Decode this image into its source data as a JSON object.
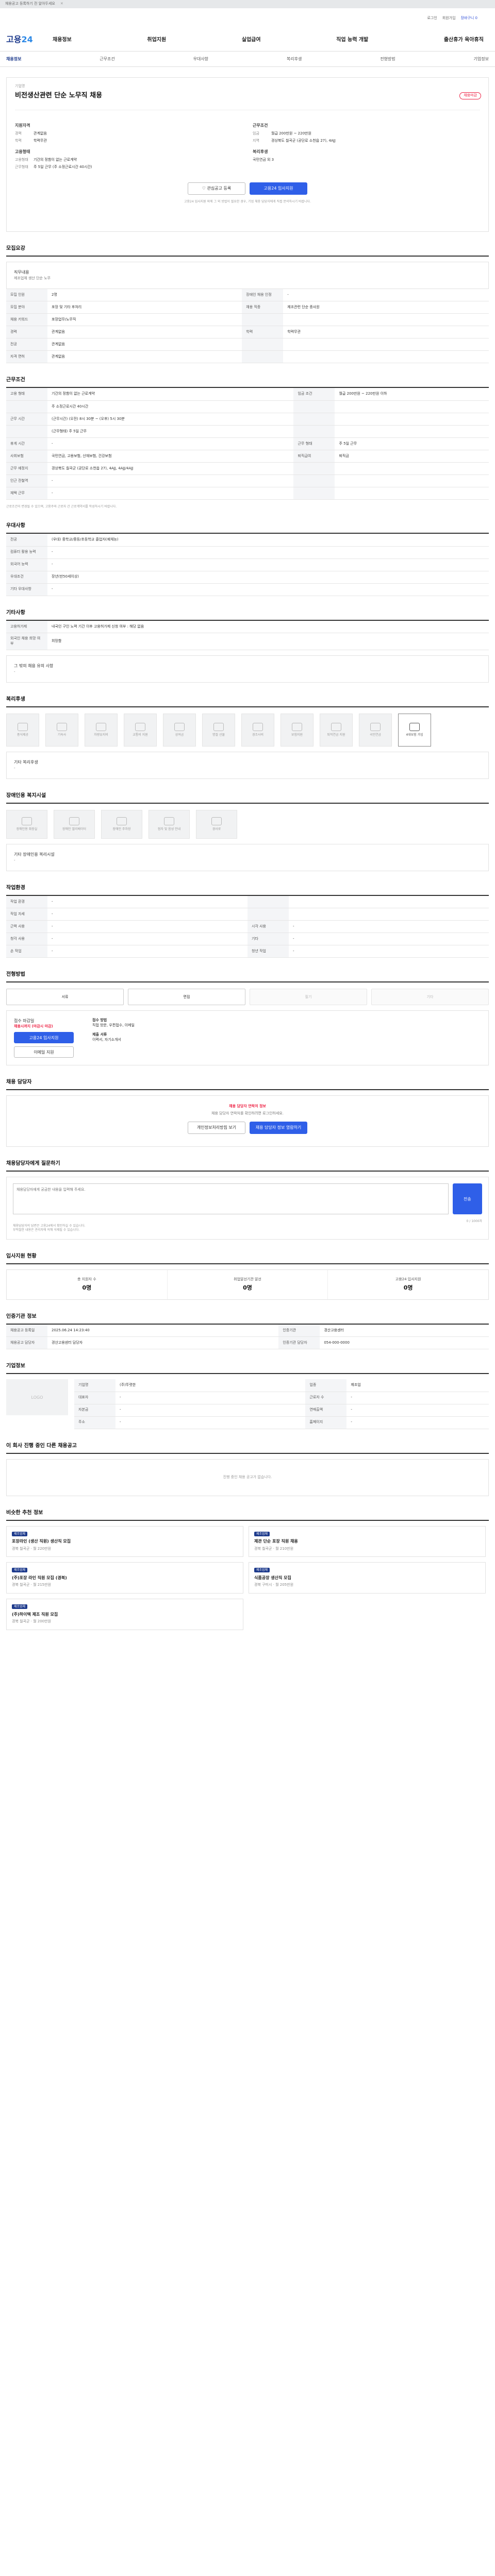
{
  "top_notice": {
    "text": "채용공고 등록하기 전 알아두세요",
    "close": "닫기"
  },
  "util": {
    "login": "로그인",
    "join": "회원가입",
    "cart": "장바구니 0"
  },
  "gnb": {
    "logo_main": "고용",
    "logo_sub": "24",
    "menu": [
      "채용정보",
      "취업지원",
      "실업급여",
      "직업 능력 개발",
      "출산휴가 육아휴직"
    ]
  },
  "tabs": [
    "채용정보",
    "근무조건",
    "우대사항",
    "복리후생",
    "전형방법",
    "기업정보"
  ],
  "header": {
    "company_label": "기업명",
    "company": "(주)뚜렷한",
    "title": "비전생산관련 단순 노무직 채용",
    "badge": "채용마감",
    "left": [
      {
        "k": "경력",
        "v": "관계없음"
      },
      {
        "k": "학력",
        "v": "학력무관"
      }
    ],
    "right_head": "근무조건",
    "right": [
      {
        "k": "임금",
        "v": "월급 200만원 ~ 220만원"
      },
      {
        "k": "지역",
        "v": "경상북도 칠곡군 (공단로 소천읍 27), 4AJJ"
      }
    ],
    "emp_head": "고용형태",
    "emp": [
      {
        "k": "고용형태",
        "v": "기간의 정함이 없는 근로계약"
      },
      {
        "k": "근무형태",
        "v": "주 5일 근무 (주 소정근로시간 40시간)"
      }
    ],
    "welfare_head": "복리후생",
    "welfare": "국민연금 외 3"
  },
  "buttons": {
    "interest": "관심공고 등록",
    "apply": "고용24 입사지원"
  },
  "apply_note": "고용24 입사지원 외에 그 외 방법이 필요한 경우, 기업 채용 담당자에게 직접 문의하시기 바랍니다.",
  "sections": {
    "recruit": "모집요강",
    "cond": "근무조건",
    "pref": "우대사항",
    "etc": "기타사항",
    "welfare": "복리후생",
    "disability": "장애인용 복지시설",
    "env": "작업환경",
    "process": "전형방법",
    "mgr": "채용 담당자",
    "inq": "채용담당자에게 질문하기",
    "status": "입사지원 현황",
    "info": "인증기관 정보",
    "company": "기업정보",
    "similar": "이 회사 진행 중인 다른 채용공고",
    "rec": "비슷한 추천 정보"
  },
  "job_box": {
    "title": "직무내용",
    "desc": "제조업체 생산 단순 노무"
  },
  "recruit_table": [
    {
      "l": "모집 인원",
      "v": "2명",
      "l2": "장애인 채용 인정",
      "v2": "-"
    },
    {
      "l": "모집 분야",
      "v": "포장 및 기타 후처리",
      "l2": "채용 직종",
      "v2": "제조관련 단순 종사원"
    },
    {
      "l": "채용 키워드",
      "v": "포장업무/노무직",
      "l2": "",
      "v2": ""
    },
    {
      "l": "경력",
      "v": "관계없음",
      "l2": "학력",
      "v2": "학력무관"
    },
    {
      "l": "전공",
      "v": "관계없음",
      "l2": "",
      "v2": ""
    },
    {
      "l": "자격 면허",
      "v": "관계없음",
      "l2": "",
      "v2": ""
    }
  ],
  "cond_table": [
    {
      "l": "고용 형태",
      "v": "기간의 정함이 없는 근로계약",
      "l2": "임금 조건",
      "v2": "월급 200만원 ~ 220만원 이하"
    },
    {
      "l": "",
      "v": "주 소정근로시간 40시간",
      "l2": "",
      "v2": ""
    },
    {
      "l": "근무 시간",
      "v": "(근무시간) (오전) 8시 30분 ~ (오후) 5시 30분",
      "l2": "",
      "v2": ""
    },
    {
      "l": "",
      "v": "(근무형태) 주 5일 근무",
      "l2": "",
      "v2": ""
    },
    {
      "l": "휴게 시간",
      "v": "-",
      "l2": "근무 형태",
      "v2": "주 5일 근무"
    },
    {
      "l": "사회보험",
      "v": "국민연금, 고용보험, 산재보험, 건강보험",
      "l2": "퇴직급여",
      "v2": "퇴직금"
    },
    {
      "l": "근무 예정지",
      "v": "경상북도 칠곡군 (공단로 소천읍 27), 4AJJ, 4AJJ/4AJJ",
      "l2": "",
      "v2": ""
    },
    {
      "l": "인근 전철역",
      "v": "-",
      "l2": "",
      "v2": ""
    },
    {
      "l": "재택 근무",
      "v": "-",
      "l2": "",
      "v2": ""
    }
  ],
  "cond_note": "근로조건이 변경될 수 있으며, 고용주와 근로자 간 근로계약서를 작성하시기 바랍니다.",
  "pref_table": [
    {
      "l": "전공",
      "v": "(우대) 중학교/중등/초등학교 졸업자(예체능)"
    },
    {
      "l": "컴퓨터 활용 능력",
      "v": "-"
    },
    {
      "l": "외국어 능력",
      "v": "-"
    },
    {
      "l": "우대조건",
      "v": "장년(만50세이상)"
    },
    {
      "l": "기타 우대사항",
      "v": "-"
    }
  ],
  "etc_table": [
    {
      "l": "고용허가제",
      "v": "내국인 구인 노력 기간 이후 고용허가제 신청 여부 : 해당 없음"
    },
    {
      "l": "외국인 채용 희망 여부",
      "v": "희망함"
    }
  ],
  "etc_box": {
    "title": "그 밖의 채용 유의 사항",
    "desc": "-"
  },
  "welfare_icons": [
    "중식제공",
    "기숙사",
    "차량유지비",
    "교통비 지원",
    "상여금",
    "명절 선물",
    "경조사비",
    "보험지원",
    "퇴직연금 지원",
    "국민연금",
    "4대보험 가입"
  ],
  "welfare_box": {
    "title": "기타 복리후생",
    "desc": "-"
  },
  "dis_icons": [
    "장애인용 화장실",
    "장애인 엘리베이터",
    "장애인 주차장",
    "점자 및 음성 안내",
    "경사로"
  ],
  "dis_box": {
    "title": "기타 장애인용 복리시설",
    "desc": "-"
  },
  "env_table": [
    {
      "l": "작업 환경",
      "v": "-",
      "l2": "",
      "v2": ""
    },
    {
      "l": "작업 자세",
      "v": "-",
      "l2": "",
      "v2": ""
    },
    {
      "l": "근력 사용",
      "v": "-",
      "l2": "시각 사용",
      "v2": "-"
    },
    {
      "l": "청각 사용",
      "v": "-",
      "l2": "기타",
      "v2": "-"
    },
    {
      "l": "손 작업",
      "v": "-",
      "l2": "청년 작업",
      "v2": "-"
    }
  ],
  "process_steps": [
    "서류",
    "면접",
    "필기",
    "기타"
  ],
  "receipt": {
    "label": "접수 마감일",
    "deadline": "채용시까지 (마감시 마감)",
    "apply_btn": "고용24 입사지원",
    "mail_btn": "이메일 지원",
    "method_label": "접수 방법",
    "method_value": "직접 방문, 우편접수, 이메일",
    "docs_label": "제출 서류",
    "docs_value": "이력서, 자기소개서"
  },
  "mgr_box": {
    "title": "채용 담당자 연락처 정보",
    "desc": "채용 담당자 연락처를 확인하려면 로그인하세요.",
    "btn1": "개인정보처리방침 보기",
    "btn2": "채용 담당자 정보 열람하기"
  },
  "inq_box": {
    "placeholder": "채용담당자에게 궁금한 내용을 입력해 주세요.",
    "count": "0 / 1000자",
    "send": "전송",
    "notes": [
      "채용담당자의 답변은 고용24에서 확인하실 수 있습니다.",
      "부적절한 내용은 관리자에 의해 삭제될 수 있습니다."
    ]
  },
  "status": [
    {
      "l": "총 지원자 수",
      "v": "0명"
    },
    {
      "l": "취업알선기관 알선",
      "v": "0명"
    },
    {
      "l": "고용24 입사지원",
      "v": "0명"
    }
  ],
  "info_table": [
    {
      "l": "채용공고 등록일",
      "v": "2025.06.24 14:23:40",
      "l2": "인증기관",
      "v2": "경산고용센터"
    },
    {
      "l": "채용공고 담당자",
      "v": "경산고용센터 담당자",
      "l2": "인증기관 담당자",
      "v2": "054-000-0000"
    }
  ],
  "company": {
    "logo_text": "LOGO",
    "rows": [
      {
        "l": "기업명",
        "v": "(주)뚜렷한",
        "l2": "업종",
        "v2": "제조업"
      },
      {
        "l": "대표자",
        "v": "-",
        "l2": "근로자 수",
        "v2": "-"
      },
      {
        "l": "자본금",
        "v": "-",
        "l2": "연매출액",
        "v2": "-"
      },
      {
        "l": "주소",
        "v": "-",
        "l2": "홈페이지",
        "v2": "-"
      }
    ]
  },
  "similar_empty": "진행 중인 채용 공고가 없습니다.",
  "recs": [
    {
      "tag": "제조업체",
      "title": "포장라인 (생산 직원) 생산직 모집",
      "meta": "경북 칠곡군 · 월 220만원"
    },
    {
      "tag": "제조업체",
      "title": "제관 단순 포장 직원 채용",
      "meta": "경북 칠곡군 · 월 210만원"
    },
    {
      "tag": "제조업체",
      "title": "(주)포장 라인 직원 모집 (경북)",
      "meta": "경북 칠곡군 · 월 215만원"
    },
    {
      "tag": "제조업체",
      "title": "식품공장 생산직 모집",
      "meta": "경북 구미시 · 월 205만원"
    },
    {
      "tag": "제조업체",
      "title": "(주)하이텍 제조 직원 모집",
      "meta": "경북 칠곡군 · 월 200만원"
    }
  ]
}
